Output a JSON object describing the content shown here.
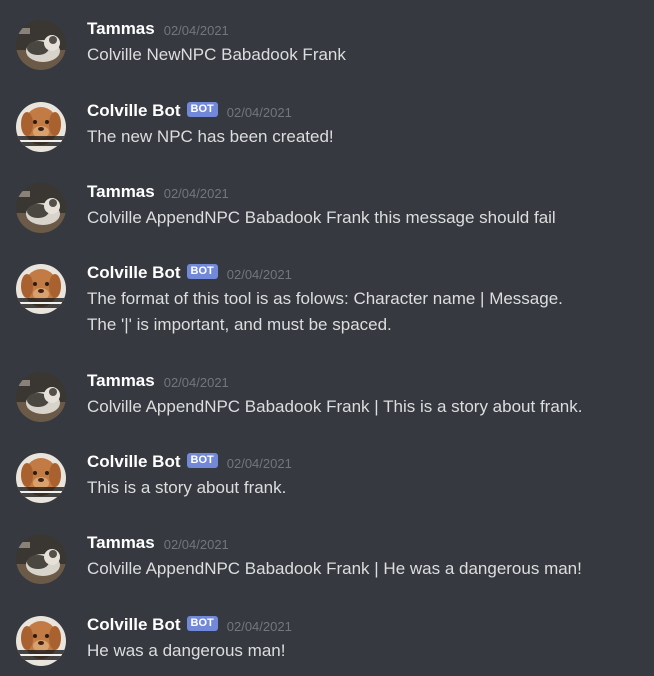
{
  "messages": [
    {
      "author": "Tammas",
      "bot": false,
      "timestamp": "02/04/2021",
      "lines": [
        "Colville NewNPC Babadook Frank"
      ]
    },
    {
      "author": "Colville Bot",
      "bot": true,
      "bot_tag": "BOT",
      "timestamp": "02/04/2021",
      "lines": [
        "The new NPC has been created!"
      ]
    },
    {
      "author": "Tammas",
      "bot": false,
      "timestamp": "02/04/2021",
      "lines": [
        "Colville AppendNPC Babadook Frank this message should fail"
      ]
    },
    {
      "author": "Colville Bot",
      "bot": true,
      "bot_tag": "BOT",
      "timestamp": "02/04/2021",
      "lines": [
        "The format of this tool is as folows: Character name | Message.",
        "The '|' is important, and must be spaced."
      ]
    },
    {
      "author": "Tammas",
      "bot": false,
      "timestamp": "02/04/2021",
      "lines": [
        "Colville AppendNPC Babadook Frank | This is a story about frank."
      ]
    },
    {
      "author": "Colville Bot",
      "bot": true,
      "bot_tag": "BOT",
      "timestamp": "02/04/2021",
      "lines": [
        "This is a story about frank."
      ]
    },
    {
      "author": "Tammas",
      "bot": false,
      "timestamp": "02/04/2021",
      "lines": [
        "Colville AppendNPC Babadook Frank | He was a dangerous man!"
      ]
    },
    {
      "author": "Colville Bot",
      "bot": true,
      "bot_tag": "BOT",
      "timestamp": "02/04/2021",
      "lines": [
        "He was a dangerous man!"
      ]
    }
  ],
  "colors": {
    "background": "#36393f",
    "username": "#ffffff",
    "message_text": "#dcddde",
    "timestamp": "#72767d",
    "bot_tag": "#7289da"
  },
  "avatars": {
    "Tammas": "cat-photo-avatar",
    "Colville Bot": "dog-photo-avatar"
  }
}
